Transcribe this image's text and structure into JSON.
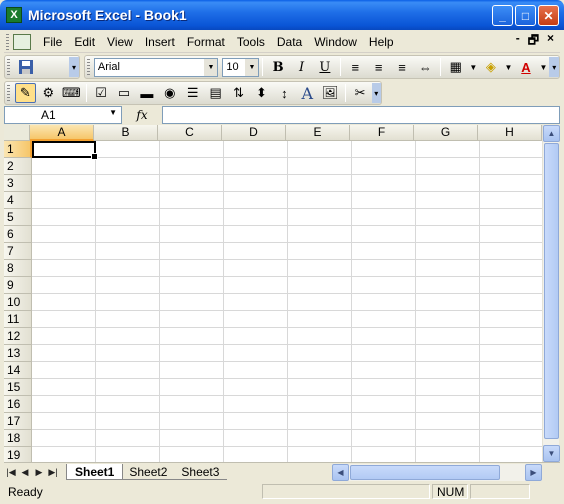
{
  "window": {
    "title": "Microsoft Excel - Book1",
    "app_icon": "X",
    "buttons": [
      "minimize",
      "maximize",
      "close"
    ]
  },
  "menu": {
    "items": [
      "File",
      "Edit",
      "View",
      "Insert",
      "Format",
      "Tools",
      "Data",
      "Window",
      "Help"
    ],
    "right": [
      "-",
      "🗗",
      "×"
    ]
  },
  "formatting": {
    "font": "Arial",
    "size": "10"
  },
  "formula_bar": {
    "name_box": "A1",
    "fx_label": "fx",
    "formula": ""
  },
  "grid": {
    "columns": [
      "A",
      "B",
      "C",
      "D",
      "E",
      "F",
      "G",
      "H"
    ],
    "rows": [
      "1",
      "2",
      "3",
      "4",
      "5",
      "6",
      "7",
      "8",
      "9",
      "10",
      "11",
      "12",
      "13",
      "14",
      "15",
      "16",
      "17",
      "18",
      "19"
    ],
    "active_cell": "A1"
  },
  "sheets": {
    "tabs": [
      "Sheet1",
      "Sheet2",
      "Sheet3"
    ],
    "active": "Sheet1"
  },
  "status": {
    "text": "Ready",
    "num": "NUM"
  },
  "colors": {
    "titlebar": "#0a55d6",
    "selection_header": "#f6c66a",
    "gridline": "#d8d8d8"
  }
}
